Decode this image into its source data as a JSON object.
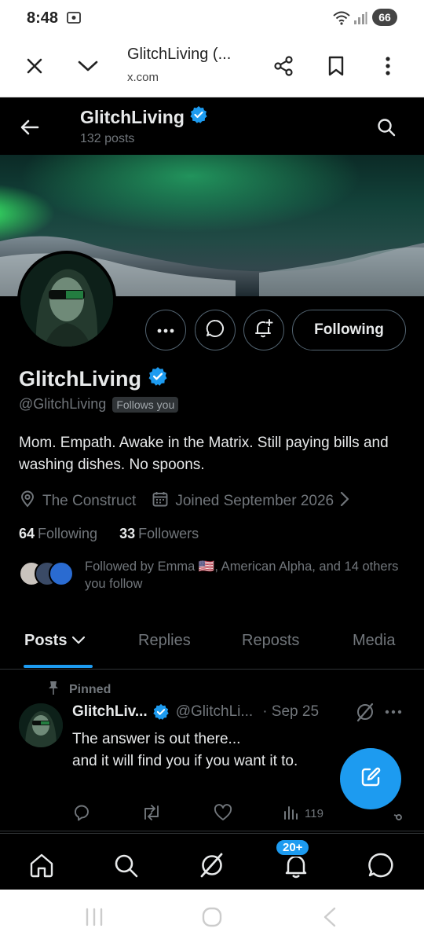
{
  "status_bar": {
    "time": "8:48",
    "battery": "66"
  },
  "browser": {
    "title": "GlitchLiving (...",
    "url": "x.com"
  },
  "header": {
    "name": "GlitchLiving",
    "post_count": "132 posts"
  },
  "profile": {
    "name": "GlitchLiving",
    "handle": "@GlitchLiving",
    "follows_you": "Follows you",
    "bio": "Mom. Empath. Awake in the Matrix. Still paying bills and washing dishes. No spoons.",
    "location": "The Construct",
    "joined": "Joined September 2026",
    "following_count": "64",
    "following_label": "Following",
    "followers_count": "33",
    "followers_label": "Followers",
    "followed_by": "Followed by Emma 🇺🇸, American Alpha, and 14 others you follow",
    "following_button": "Following"
  },
  "tabs": [
    {
      "label": "Posts"
    },
    {
      "label": "Replies"
    },
    {
      "label": "Reposts"
    },
    {
      "label": "Media"
    }
  ],
  "pinned_tweet": {
    "pinned_label": "Pinned",
    "name": "GlitchLiv...",
    "handle": "@GlitchLi...",
    "date": "· Sep 25",
    "text_line1": "The answer is out there...",
    "text_line2": "and it will find you if you want it to.",
    "views": "119"
  },
  "nav": {
    "notifications_badge": "20+"
  },
  "colors": {
    "accent": "#1d9bf0",
    "background": "#000000",
    "muted": "#71767b",
    "text": "#e7e9ea"
  },
  "icons": {
    "browser": [
      "close-icon",
      "chevron-down-icon",
      "share-icon",
      "bookmark-icon",
      "more-vertical-icon"
    ],
    "header": [
      "back-arrow-icon",
      "verified-badge-icon",
      "search-icon"
    ],
    "actions": [
      "more-horizontal-icon",
      "message-icon",
      "notification-add-icon"
    ],
    "meta": [
      "location-icon",
      "calendar-icon",
      "chevron-right-icon"
    ],
    "tweet": [
      "pin-icon",
      "grok-icon",
      "reply-icon",
      "repost-icon",
      "like-icon",
      "views-icon",
      "share-icon"
    ],
    "nav": [
      "home-icon",
      "search-icon",
      "grok-icon",
      "notifications-icon",
      "messages-icon"
    ],
    "fab": "compose-icon"
  }
}
